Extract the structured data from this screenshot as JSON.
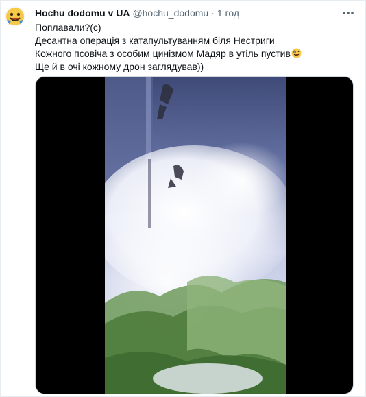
{
  "tweet": {
    "author": {
      "display_name": "Hochu dodomu v UA",
      "handle": "@hochu_dodomu",
      "separator": "·",
      "time": "1 год",
      "avatar_icon": "smiley-face-avatar"
    },
    "more_icon": "more-horizontal-icon",
    "text_lines": [
      "Поплавали?(с)",
      "Десантна операція з катапультуванням біля Нестриги",
      "Кожного псовіча з особим цинізмом Мадяр в утіль пустив",
      "Ще й в очі кожному дрон заглядував))"
    ],
    "emoji_icon": "zany-face-emoji",
    "media": {
      "type": "video",
      "background_color": "#000000"
    }
  }
}
